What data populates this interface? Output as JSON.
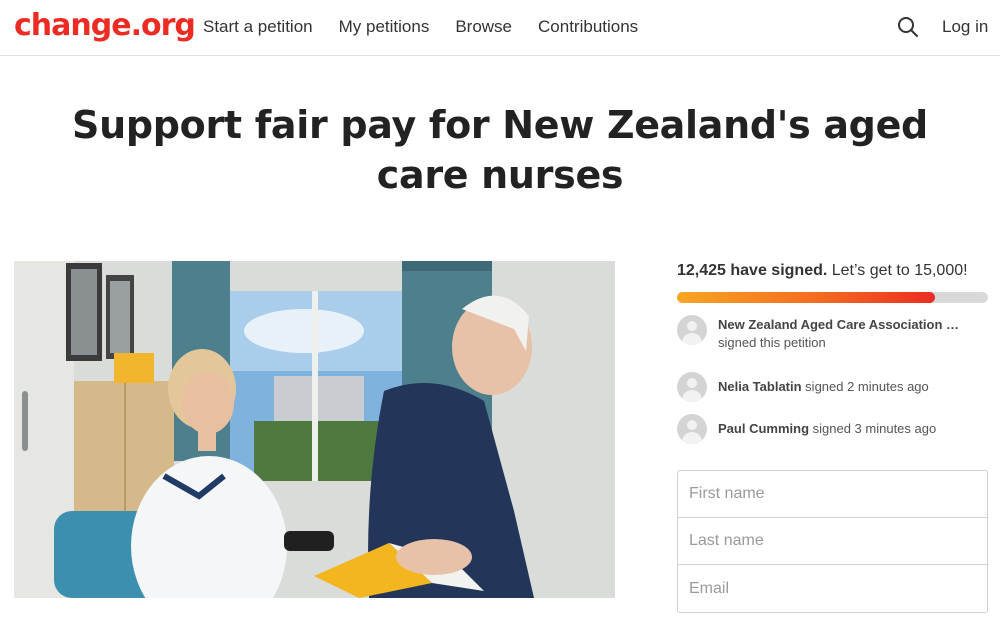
{
  "brand": {
    "logo_text": "change.org",
    "color": "#ec2c22"
  },
  "nav": {
    "items": [
      "Start a petition",
      "My petitions",
      "Browse",
      "Contributions"
    ],
    "search_icon": "search-icon",
    "login_label": "Log in"
  },
  "petition": {
    "title": "Support fair pay for New Zealand's aged care nurses",
    "image_alt": "Aged care nurse sitting with an elderly resident"
  },
  "signatures": {
    "count_text": "12,425 have signed.",
    "goal_text": " Let’s get to 15,000!",
    "progress_fraction": 0.8283
  },
  "recent_signers": [
    {
      "name": "New Zealand Aged Care Association W...",
      "action": "signed this petition"
    },
    {
      "name": "Nelia Tablatin",
      "action": " signed 2 minutes ago"
    },
    {
      "name": "Paul Cumming",
      "action": " signed 3 minutes ago"
    }
  ],
  "form": {
    "first_name_placeholder": "First name",
    "last_name_placeholder": "Last name",
    "email_placeholder": "Email"
  }
}
